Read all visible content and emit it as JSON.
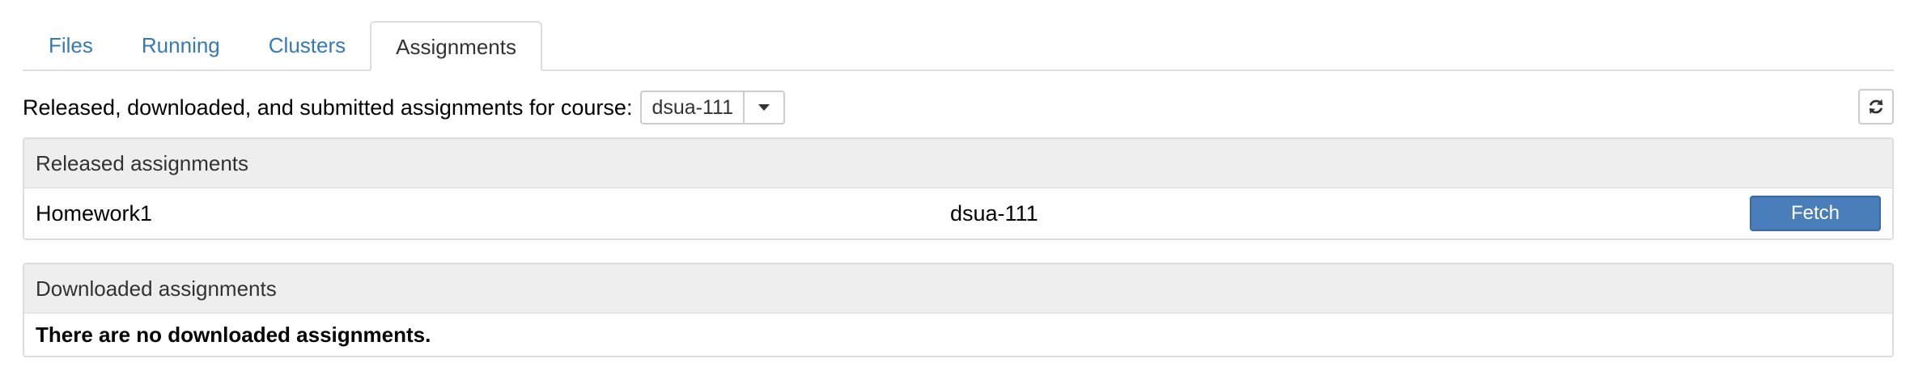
{
  "tabs": [
    {
      "label": "Files",
      "active": false
    },
    {
      "label": "Running",
      "active": false
    },
    {
      "label": "Clusters",
      "active": false
    },
    {
      "label": "Assignments",
      "active": true
    }
  ],
  "course_selector": {
    "label": "Released, downloaded, and submitted assignments for course:",
    "selected": "dsua-111"
  },
  "released_panel": {
    "heading": "Released assignments",
    "rows": [
      {
        "name": "Homework1",
        "course": "dsua-111",
        "action": "Fetch"
      }
    ]
  },
  "downloaded_panel": {
    "heading": "Downloaded assignments",
    "empty_message": "There are no downloaded assignments."
  },
  "colors": {
    "link": "#337ab7",
    "primary_button": "#4a7ebb",
    "panel_heading_bg": "#eeeeee",
    "border": "#dddddd"
  },
  "icons": {
    "refresh": "refresh-icon",
    "dropdown": "caret-down-icon"
  }
}
